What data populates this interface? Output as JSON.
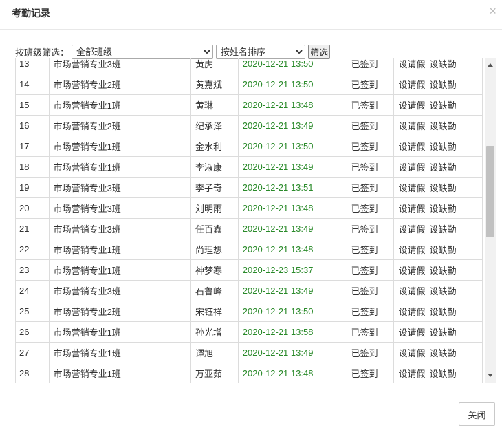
{
  "dialog": {
    "title": "考勤记录",
    "close_glyph": "×"
  },
  "filter": {
    "label": "按班级筛选：",
    "class_select_value": "全部班级",
    "sort_select_value": "按姓名排序",
    "button_label": "筛选"
  },
  "table": {
    "rows": [
      {
        "no": "13",
        "class": "市场营销专业3班",
        "name": "黄虎",
        "time": "2020-12-21 13:50",
        "status": "已签到",
        "leave": "设请假",
        "absent": "设缺勤"
      },
      {
        "no": "14",
        "class": "市场营销专业2班",
        "name": "黄嘉斌",
        "time": "2020-12-21 13:50",
        "status": "已签到",
        "leave": "设请假",
        "absent": "设缺勤"
      },
      {
        "no": "15",
        "class": "市场营销专业1班",
        "name": "黄琳",
        "time": "2020-12-21 13:48",
        "status": "已签到",
        "leave": "设请假",
        "absent": "设缺勤"
      },
      {
        "no": "16",
        "class": "市场营销专业2班",
        "name": "纪承泽",
        "time": "2020-12-21 13:49",
        "status": "已签到",
        "leave": "设请假",
        "absent": "设缺勤"
      },
      {
        "no": "17",
        "class": "市场营销专业1班",
        "name": "金水利",
        "time": "2020-12-21 13:50",
        "status": "已签到",
        "leave": "设请假",
        "absent": "设缺勤"
      },
      {
        "no": "18",
        "class": "市场营销专业1班",
        "name": "李淑康",
        "time": "2020-12-21 13:49",
        "status": "已签到",
        "leave": "设请假",
        "absent": "设缺勤"
      },
      {
        "no": "19",
        "class": "市场营销专业3班",
        "name": "李子奇",
        "time": "2020-12-21 13:51",
        "status": "已签到",
        "leave": "设请假",
        "absent": "设缺勤"
      },
      {
        "no": "20",
        "class": "市场营销专业3班",
        "name": "刘明雨",
        "time": "2020-12-21 13:48",
        "status": "已签到",
        "leave": "设请假",
        "absent": "设缺勤"
      },
      {
        "no": "21",
        "class": "市场营销专业3班",
        "name": "任百鑫",
        "time": "2020-12-21 13:49",
        "status": "已签到",
        "leave": "设请假",
        "absent": "设缺勤"
      },
      {
        "no": "22",
        "class": "市场营销专业1班",
        "name": "尚理想",
        "time": "2020-12-21 13:48",
        "status": "已签到",
        "leave": "设请假",
        "absent": "设缺勤"
      },
      {
        "no": "23",
        "class": "市场营销专业1班",
        "name": "神梦寒",
        "time": "2020-12-23 15:37",
        "status": "已签到",
        "leave": "设请假",
        "absent": "设缺勤"
      },
      {
        "no": "24",
        "class": "市场营销专业3班",
        "name": "石鲁峰",
        "time": "2020-12-21 13:49",
        "status": "已签到",
        "leave": "设请假",
        "absent": "设缺勤"
      },
      {
        "no": "25",
        "class": "市场营销专业2班",
        "name": "宋钰祥",
        "time": "2020-12-21 13:50",
        "status": "已签到",
        "leave": "设请假",
        "absent": "设缺勤"
      },
      {
        "no": "26",
        "class": "市场营销专业1班",
        "name": "孙光增",
        "time": "2020-12-21 13:58",
        "status": "已签到",
        "leave": "设请假",
        "absent": "设缺勤"
      },
      {
        "no": "27",
        "class": "市场营销专业1班",
        "name": "谭旭",
        "time": "2020-12-21 13:49",
        "status": "已签到",
        "leave": "设请假",
        "absent": "设缺勤"
      },
      {
        "no": "28",
        "class": "市场营销专业1班",
        "name": "万亚茹",
        "time": "2020-12-21 13:48",
        "status": "已签到",
        "leave": "设请假",
        "absent": "设缺勤"
      }
    ]
  },
  "colors": {
    "time_text": "#2a8a2a",
    "grid_border": "#dcdcdc"
  },
  "footer": {
    "close_label": "关闭"
  }
}
